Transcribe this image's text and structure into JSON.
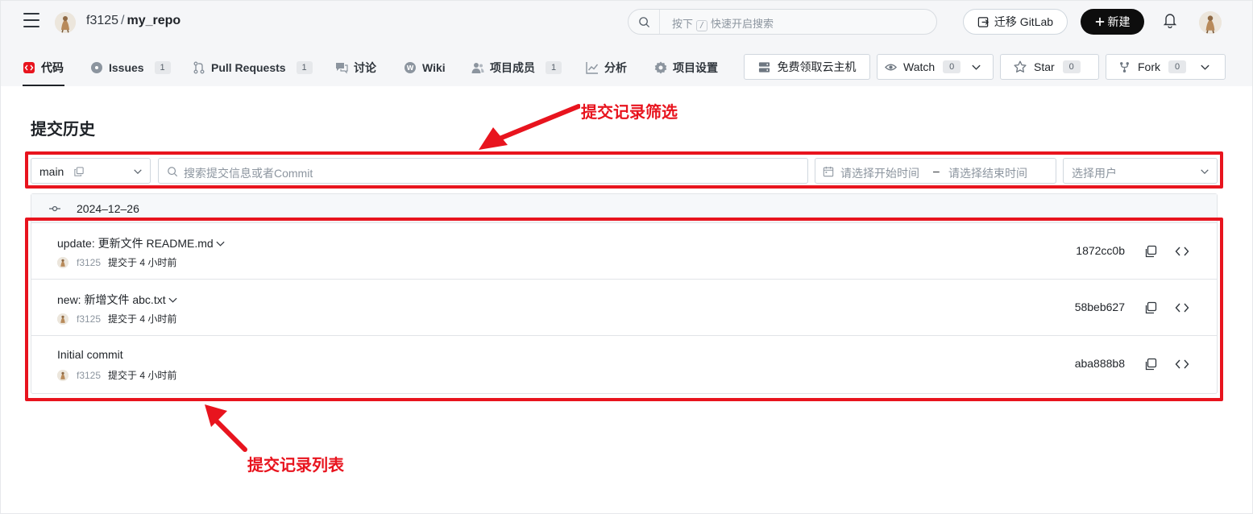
{
  "header": {
    "owner": "f3125",
    "separator": "/",
    "repo": "my_repo",
    "search": {
      "prefix": "按下",
      "key": "/",
      "suffix": "快速开启搜索"
    },
    "migrate_label": "迁移 GitLab",
    "new_label": "新建"
  },
  "tabs": [
    {
      "label": "代码",
      "active": true
    },
    {
      "label": "Issues",
      "count": "1"
    },
    {
      "label": "Pull Requests",
      "count": "1"
    },
    {
      "label": "讨论"
    },
    {
      "label": "Wiki"
    },
    {
      "label": "项目成员",
      "count": "1"
    },
    {
      "label": "分析"
    },
    {
      "label": "项目设置"
    }
  ],
  "actions": {
    "cloud_label": "免费领取云主机",
    "watch_label": "Watch",
    "watch_count": "0",
    "star_label": "Star",
    "star_count": "0",
    "fork_label": "Fork",
    "fork_count": "0"
  },
  "page": {
    "title": "提交历史"
  },
  "filters": {
    "branch": "main",
    "search_placeholder": "搜索提交信息或者Commit",
    "start_placeholder": "请选择开始时间",
    "range_dash": "–",
    "end_placeholder": "请选择结束时间",
    "user_placeholder": "选择用户"
  },
  "commit_group": {
    "date": "2024–12–26",
    "commits": [
      {
        "message": "update: 更新文件 README.md",
        "expandable": true,
        "author": "f3125",
        "time": "提交于 4 小时前",
        "sha": "1872cc0b"
      },
      {
        "message": "new: 新增文件 abc.txt",
        "expandable": true,
        "author": "f3125",
        "time": "提交于 4 小时前",
        "sha": "58beb627"
      },
      {
        "message": "Initial commit",
        "expandable": false,
        "author": "f3125",
        "time": "提交于 4 小时前",
        "sha": "aba888b8"
      }
    ]
  },
  "annotations": {
    "filter_label": "提交记录筛选",
    "list_label": "提交记录列表",
    "color": "#e8141e"
  }
}
